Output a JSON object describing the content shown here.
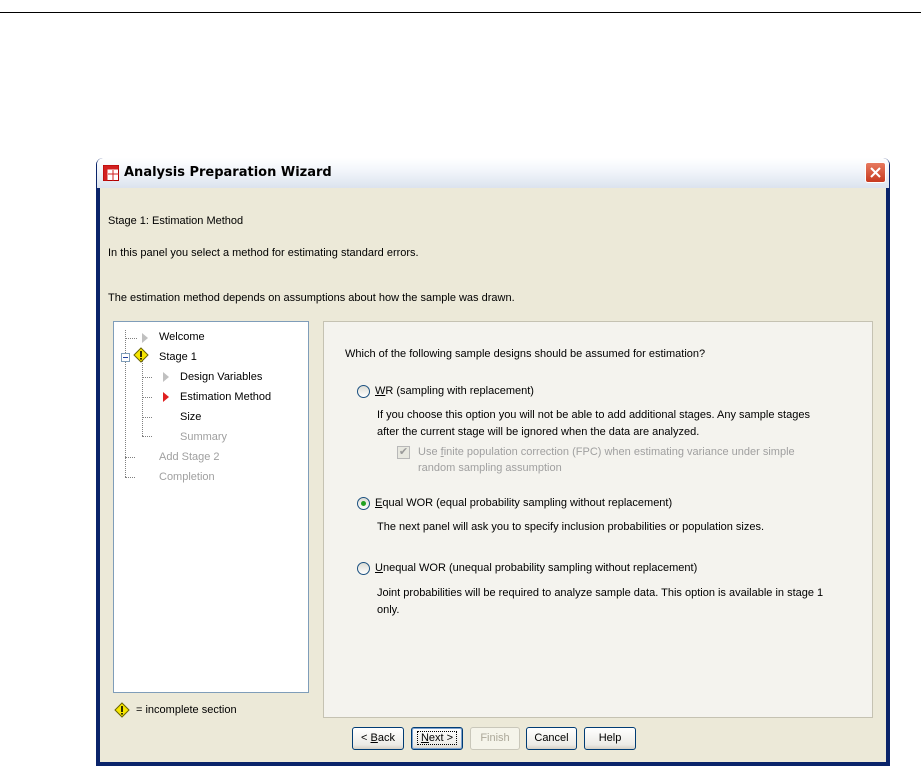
{
  "window": {
    "title": "Analysis Preparation Wizard"
  },
  "header": {
    "stage_title": "Stage 1: Estimation Method",
    "intro": "In this panel you select a method for estimating standard errors.",
    "assumption_note": "The estimation method depends on assumptions about how the sample was drawn."
  },
  "tree": {
    "items": [
      {
        "label": "Welcome",
        "state": "done"
      },
      {
        "label": "Stage 1",
        "state": "incomplete"
      },
      {
        "label": "Design Variables",
        "state": "done"
      },
      {
        "label": "Estimation Method",
        "state": "current"
      },
      {
        "label": "Size",
        "state": "pending"
      },
      {
        "label": "Summary",
        "state": "disabled"
      },
      {
        "label": "Add Stage 2",
        "state": "disabled"
      },
      {
        "label": "Completion",
        "state": "disabled"
      }
    ]
  },
  "legend": {
    "text": "= incomplete section",
    "icon": "warning-diamond-icon"
  },
  "panel": {
    "question": "Which of the following sample designs should be assumed for estimation?",
    "options": [
      {
        "mnemonic": "W",
        "label_rest": "R (sampling with replacement)",
        "selected": false,
        "desc_line1": "If you choose this option you will not be able to add additional stages. Any sample stages",
        "desc_line2": "after the current stage will be ignored when the data are analyzed."
      },
      {
        "mnemonic": "E",
        "label_rest": "qual WOR (equal probability sampling without replacement)",
        "selected": true,
        "desc_line1": "The next panel will ask you to specify inclusion probabilities or population sizes."
      },
      {
        "mnemonic": "U",
        "label_rest": "nequal WOR (unequal probability sampling without replacement)",
        "selected": false,
        "desc_line1": "Joint probabilities will be required to analyze sample data. This option is available in stage 1",
        "desc_line2": "only."
      }
    ],
    "fpc": {
      "pre": "Use ",
      "mnemonic": "f",
      "post": "inite population correction (FPC) when estimating variance under simple",
      "line2": "random sampling assumption",
      "checked": true,
      "enabled": false
    }
  },
  "buttons": {
    "back_pre": "< ",
    "back_mnemonic": "B",
    "back_post": "ack",
    "next_mnemonic": "N",
    "next_post": "ext >",
    "finish": "Finish",
    "cancel": "Cancel",
    "help": "Help"
  }
}
